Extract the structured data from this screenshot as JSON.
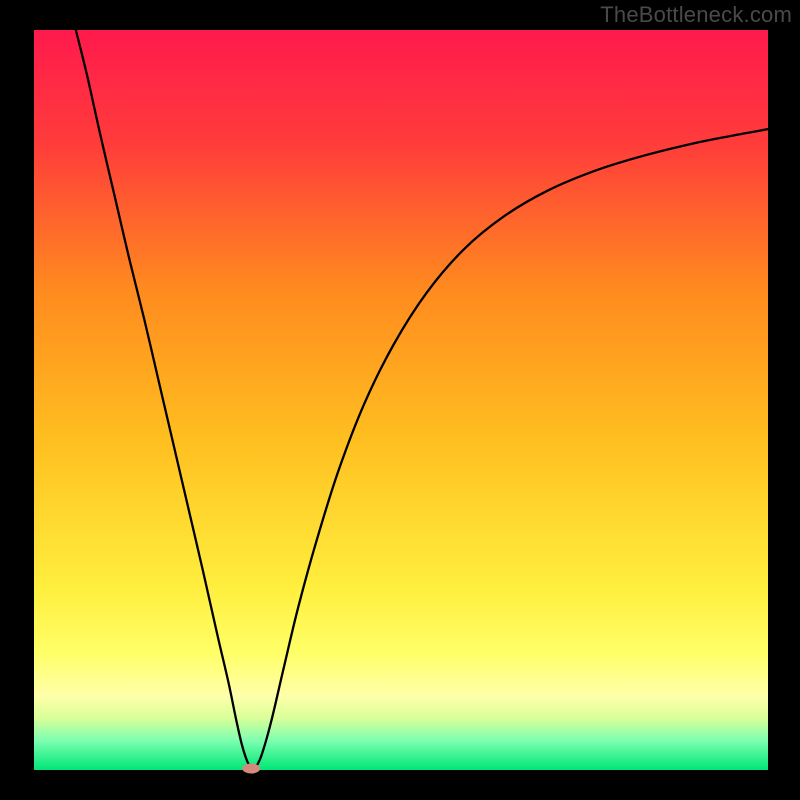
{
  "attribution": "TheBottleneck.com",
  "chart_data": {
    "type": "line",
    "title": "",
    "xlabel": "",
    "ylabel": "",
    "xlim": [
      0,
      100
    ],
    "ylim": [
      0,
      100
    ],
    "gradient_stops": [
      {
        "offset": 0.0,
        "color": "#ff1a4d"
      },
      {
        "offset": 0.15,
        "color": "#ff3b3b"
      },
      {
        "offset": 0.35,
        "color": "#ff8a1f"
      },
      {
        "offset": 0.55,
        "color": "#ffbe1f"
      },
      {
        "offset": 0.75,
        "color": "#ffee3d"
      },
      {
        "offset": 0.84,
        "color": "#ffff66"
      },
      {
        "offset": 0.9,
        "color": "#ffffaa"
      },
      {
        "offset": 0.93,
        "color": "#d9ff99"
      },
      {
        "offset": 0.96,
        "color": "#7dffb0"
      },
      {
        "offset": 1.0,
        "color": "#00e676"
      }
    ],
    "curve": [
      {
        "x": 5.7,
        "y": 100.0
      },
      {
        "x": 7.2,
        "y": 94.0
      },
      {
        "x": 9.0,
        "y": 86.0
      },
      {
        "x": 11.0,
        "y": 77.5
      },
      {
        "x": 13.0,
        "y": 69.0
      },
      {
        "x": 15.0,
        "y": 61.0
      },
      {
        "x": 17.0,
        "y": 52.5
      },
      {
        "x": 19.0,
        "y": 44.0
      },
      {
        "x": 21.0,
        "y": 35.5
      },
      {
        "x": 23.0,
        "y": 27.0
      },
      {
        "x": 25.0,
        "y": 18.2
      },
      {
        "x": 26.5,
        "y": 11.8
      },
      {
        "x": 27.5,
        "y": 7.0
      },
      {
        "x": 28.3,
        "y": 3.5
      },
      {
        "x": 29.0,
        "y": 1.3
      },
      {
        "x": 29.5,
        "y": 0.4
      },
      {
        "x": 29.8,
        "y": 0.15
      },
      {
        "x": 30.2,
        "y": 0.4
      },
      {
        "x": 31.0,
        "y": 2.0
      },
      {
        "x": 32.3,
        "y": 6.5
      },
      {
        "x": 34.0,
        "y": 13.7
      },
      {
        "x": 36.0,
        "y": 22.0
      },
      {
        "x": 38.5,
        "y": 31.0
      },
      {
        "x": 41.5,
        "y": 40.5
      },
      {
        "x": 45.0,
        "y": 49.5
      },
      {
        "x": 49.0,
        "y": 57.5
      },
      {
        "x": 53.5,
        "y": 64.5
      },
      {
        "x": 58.5,
        "y": 70.3
      },
      {
        "x": 64.0,
        "y": 74.8
      },
      {
        "x": 70.0,
        "y": 78.3
      },
      {
        "x": 76.5,
        "y": 81.0
      },
      {
        "x": 83.0,
        "y": 83.0
      },
      {
        "x": 89.5,
        "y": 84.6
      },
      {
        "x": 95.0,
        "y": 85.7
      },
      {
        "x": 100.0,
        "y": 86.6
      }
    ],
    "marker": {
      "x": 29.6,
      "y": 0.2,
      "color": "#d48a7a",
      "rx": 9,
      "ry": 5
    }
  }
}
